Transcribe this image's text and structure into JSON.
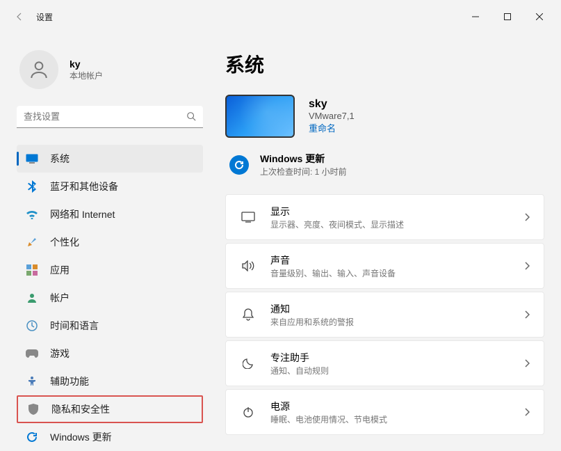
{
  "window": {
    "title": "设置"
  },
  "user": {
    "name": "ky",
    "subtitle": "本地帐户"
  },
  "search": {
    "placeholder": "查找设置"
  },
  "sidebar": {
    "items": [
      {
        "label": "系统"
      },
      {
        "label": "蓝牙和其他设备"
      },
      {
        "label": "网络和 Internet"
      },
      {
        "label": "个性化"
      },
      {
        "label": "应用"
      },
      {
        "label": "帐户"
      },
      {
        "label": "时间和语言"
      },
      {
        "label": "游戏"
      },
      {
        "label": "辅助功能"
      },
      {
        "label": "隐私和安全性"
      },
      {
        "label": "Windows 更新"
      }
    ]
  },
  "page": {
    "title": "系统",
    "device": {
      "name": "sky",
      "model": "VMware7,1",
      "rename": "重命名"
    },
    "update": {
      "title": "Windows 更新",
      "subtitle": "上次检查时间: 1 小时前"
    },
    "cards": [
      {
        "title": "显示",
        "subtitle": "显示器、亮度、夜间模式、显示描述"
      },
      {
        "title": "声音",
        "subtitle": "音量级别、输出、输入、声音设备"
      },
      {
        "title": "通知",
        "subtitle": "来自应用和系统的警报"
      },
      {
        "title": "专注助手",
        "subtitle": "通知、自动规则"
      },
      {
        "title": "电源",
        "subtitle": "睡眠、电池使用情况、节电模式"
      }
    ]
  }
}
